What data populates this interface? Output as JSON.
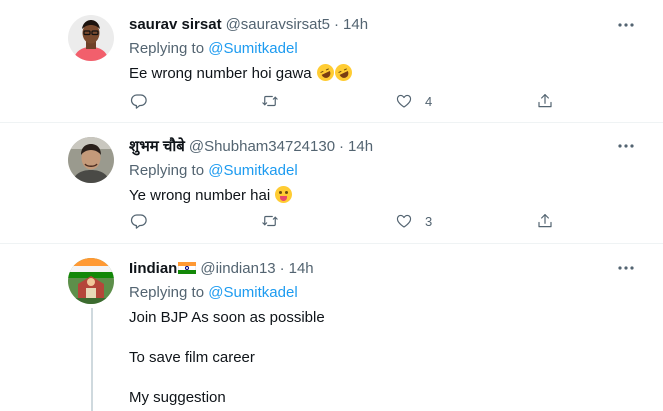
{
  "tweets": [
    {
      "name": "saurav sirsat",
      "handle": "@sauravsirsat5",
      "separator": "·",
      "time": "14h",
      "replying_prefix": "Replying to",
      "replying_to": "@Sumitkadel",
      "text": "Ee wrong number hoi gawa",
      "text_emoji": [
        "rolling-on-floor-laughing-emoji",
        "rolling-on-floor-laughing-emoji"
      ],
      "likes": "4"
    },
    {
      "name": "शुभम चौबे",
      "handle": "@Shubham34724130",
      "separator": "·",
      "time": "14h",
      "replying_prefix": "Replying to",
      "replying_to": "@Sumitkadel",
      "text": "Ye wrong number hai",
      "text_emoji": [
        "face-with-tongue-emoji"
      ],
      "likes": "3"
    },
    {
      "name": "Iindian",
      "name_emoji": "india-flag",
      "handle": "@iindian13",
      "separator": "·",
      "time": "14h",
      "replying_prefix": "Replying to",
      "replying_to": "@Sumitkadel",
      "lines": [
        "Join BJP As soon as possible",
        "To save film career",
        "My suggestion"
      ]
    }
  ],
  "icons": {
    "more": "more-horizontal-icon",
    "reply": "reply-icon",
    "retweet": "retweet-icon",
    "like": "heart-icon",
    "share": "share-icon"
  },
  "colors": {
    "link": "#1d9bf0",
    "secondary_text": "#536471",
    "primary_text": "#0f1419",
    "divider": "#eff3f4"
  }
}
